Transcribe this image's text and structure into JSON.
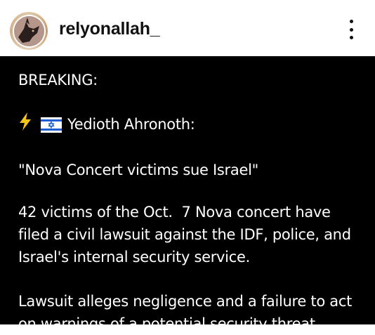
{
  "header": {
    "username": "relyonallah_",
    "more_icon": "more-vertical-icon"
  },
  "post": {
    "heading": "BREAKING:",
    "source_icons": [
      "lightning-icon",
      "israel-flag-icon"
    ],
    "source": "Yedioth Ahronoth:",
    "quote": "\"Nova Concert victims sue Israel\"",
    "paragraph1": [
      "42 victims of the Oct.  7 Nova concert have",
      "filed a civil lawsuit against the IDF, police, and",
      "Israel's internal security service."
    ],
    "paragraph2": [
      "Lawsuit alleges negligence and a failure to act",
      "on warnings of a potential security threat."
    ]
  },
  "colors": {
    "post_background": "#000000",
    "post_text": "#ffffff",
    "bolt": "#f5c518",
    "flag_blue": "#1f5fd1"
  }
}
